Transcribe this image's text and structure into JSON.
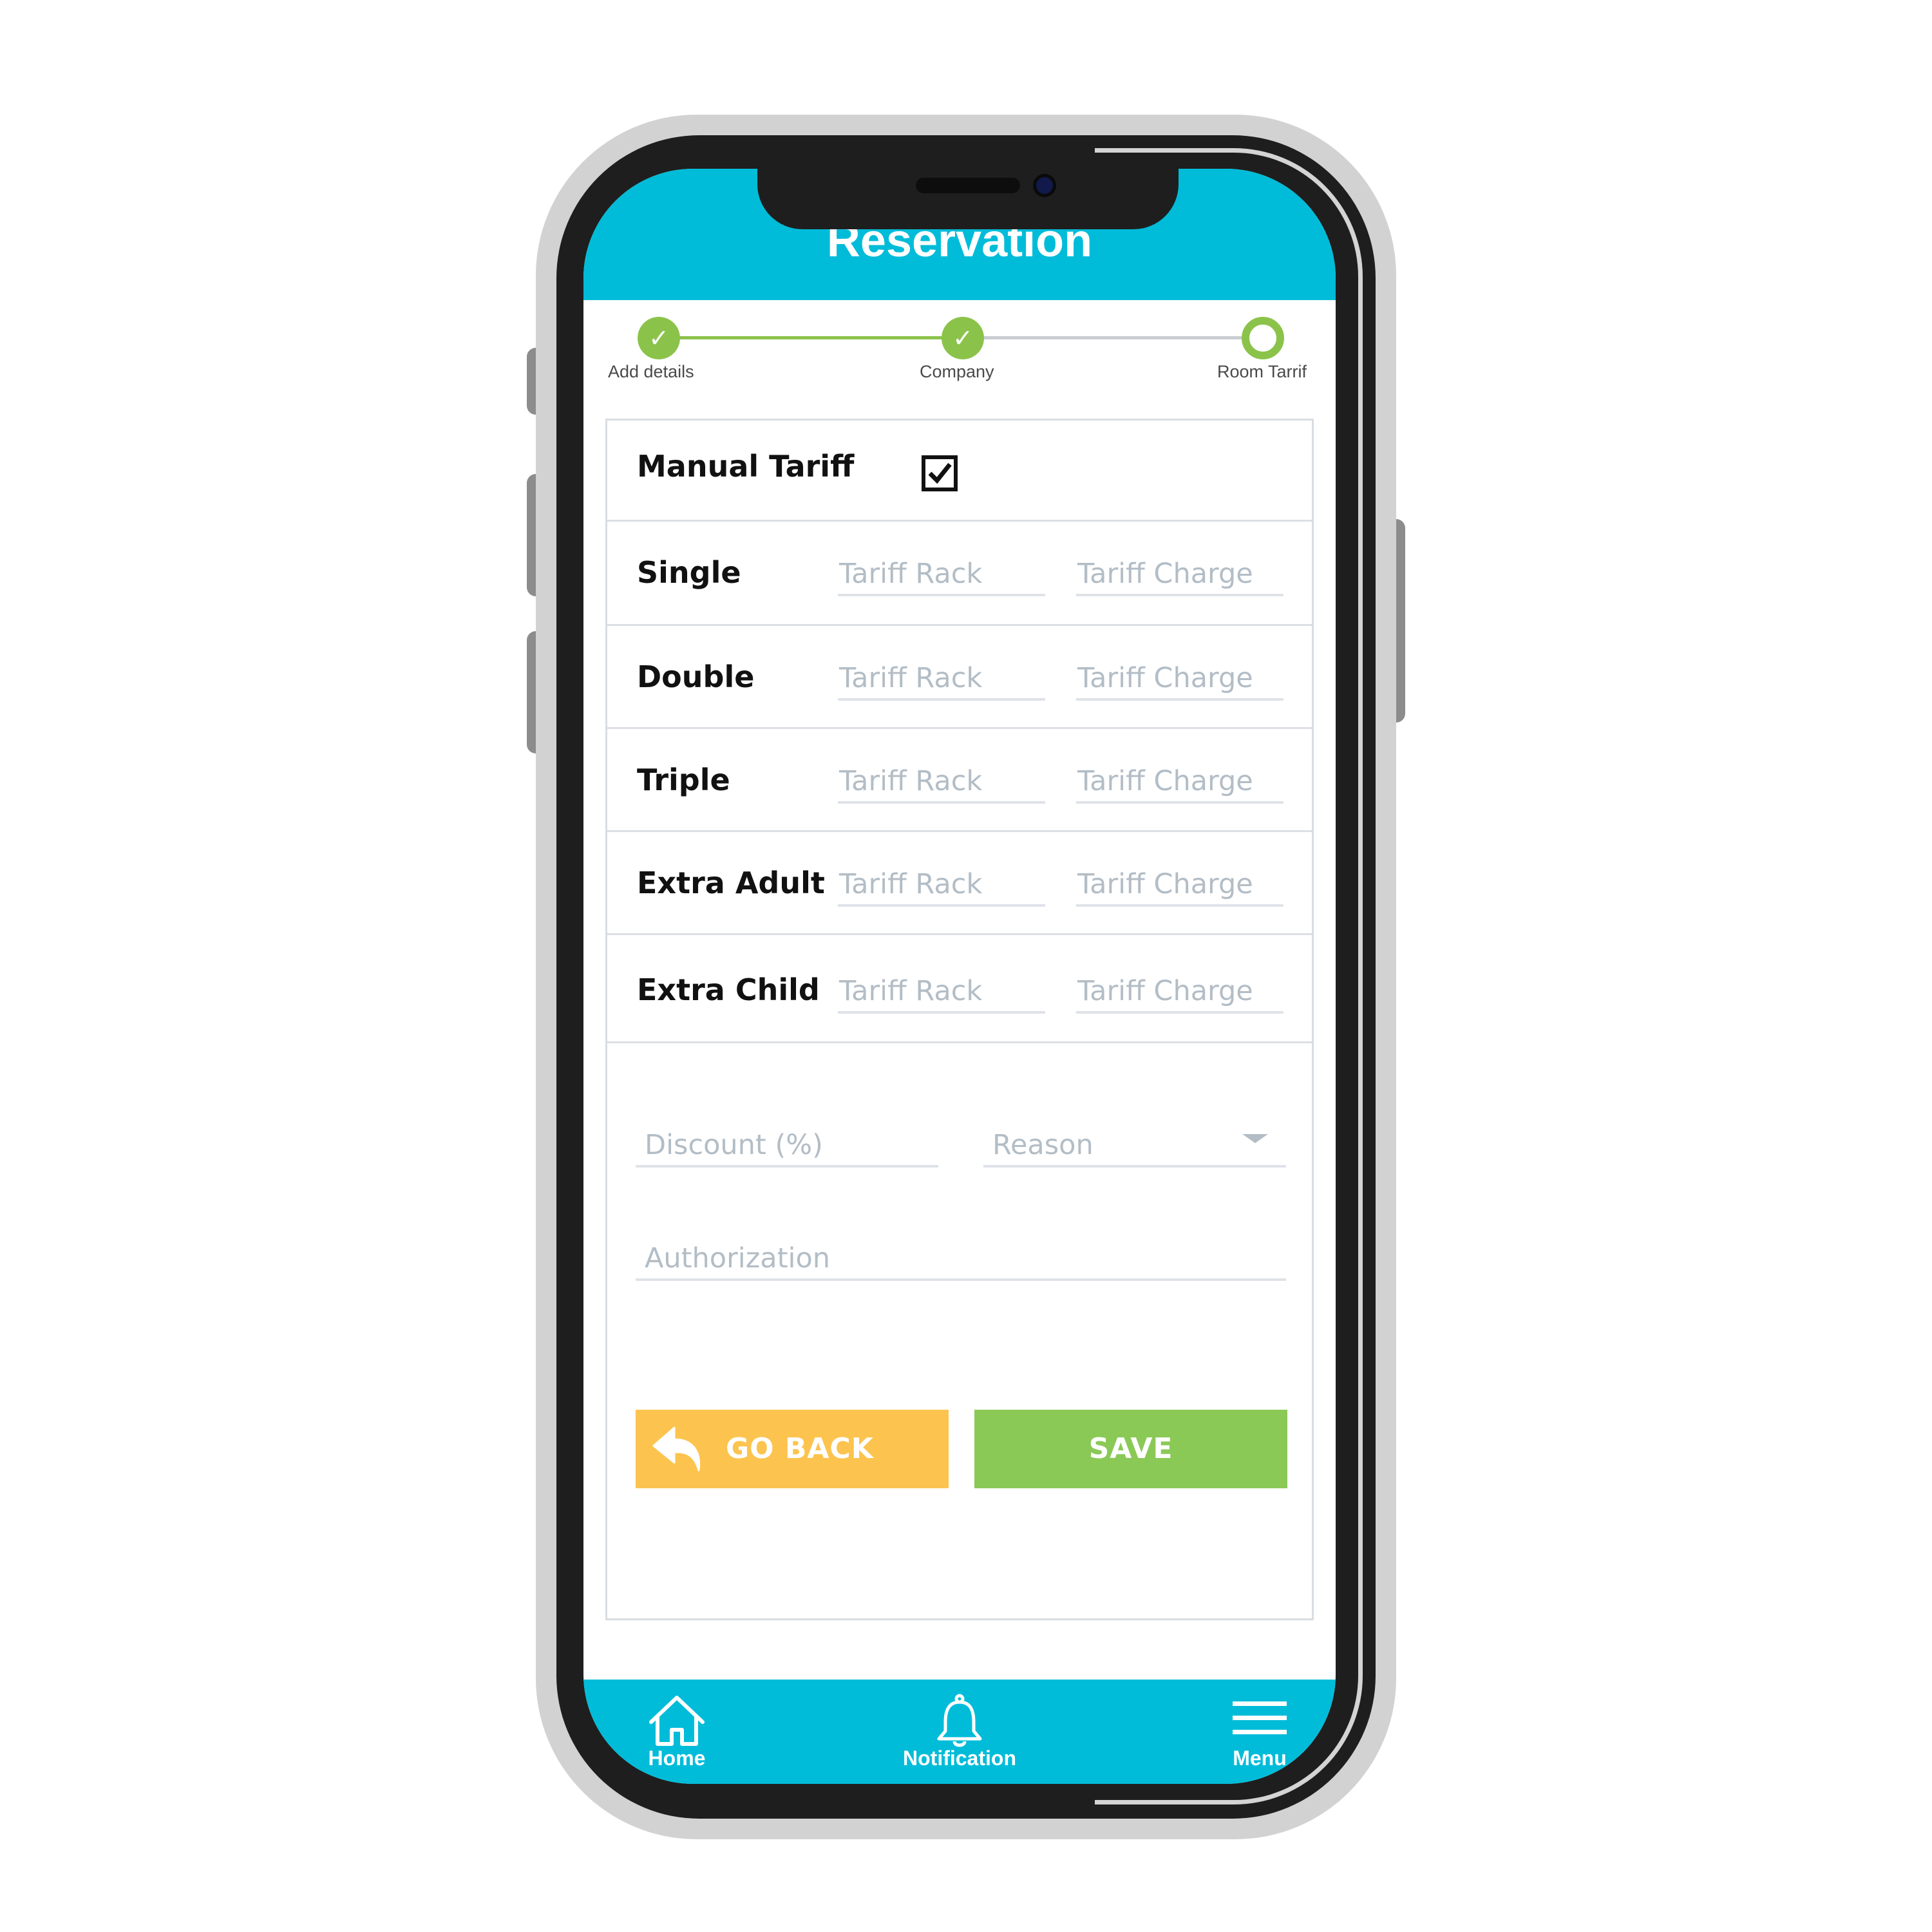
{
  "header": {
    "title": "Reservation"
  },
  "stepper": {
    "steps": [
      {
        "label": "Add details",
        "state": "done"
      },
      {
        "label": "Company",
        "state": "done"
      },
      {
        "label": "Room Tarrif",
        "state": "current"
      }
    ],
    "check_glyph": "✓"
  },
  "form": {
    "manual_tariff": {
      "label": "Manual Tariff",
      "checked": true
    },
    "rows": [
      {
        "label": "Single",
        "rack_placeholder": "Tariff Rack",
        "charge_placeholder": "Tariff Charge"
      },
      {
        "label": "Double",
        "rack_placeholder": "Tariff Rack",
        "charge_placeholder": "Tariff Charge"
      },
      {
        "label": "Triple",
        "rack_placeholder": "Tariff Rack",
        "charge_placeholder": "Tariff Charge"
      },
      {
        "label": "Extra Adult",
        "rack_placeholder": "Tariff Rack",
        "charge_placeholder": "Tariff Charge"
      },
      {
        "label": "Extra Child",
        "rack_placeholder": "Tariff Rack",
        "charge_placeholder": "Tariff Charge"
      }
    ],
    "discount_placeholder": "Discount (%)",
    "reason_placeholder": "Reason",
    "authorization_placeholder": "Authorization"
  },
  "actions": {
    "go_back_label": "GO BACK",
    "save_label": "SAVE"
  },
  "bottom_nav": {
    "items": [
      {
        "label": "Home",
        "icon": "home-icon"
      },
      {
        "label": "Notification",
        "icon": "bell-icon"
      },
      {
        "label": "Menu",
        "icon": "menu-icon"
      }
    ]
  },
  "colors": {
    "primary": "#00bcd9",
    "success": "#8bc34a",
    "warning": "#fcc44f",
    "save": "#8bc957"
  }
}
